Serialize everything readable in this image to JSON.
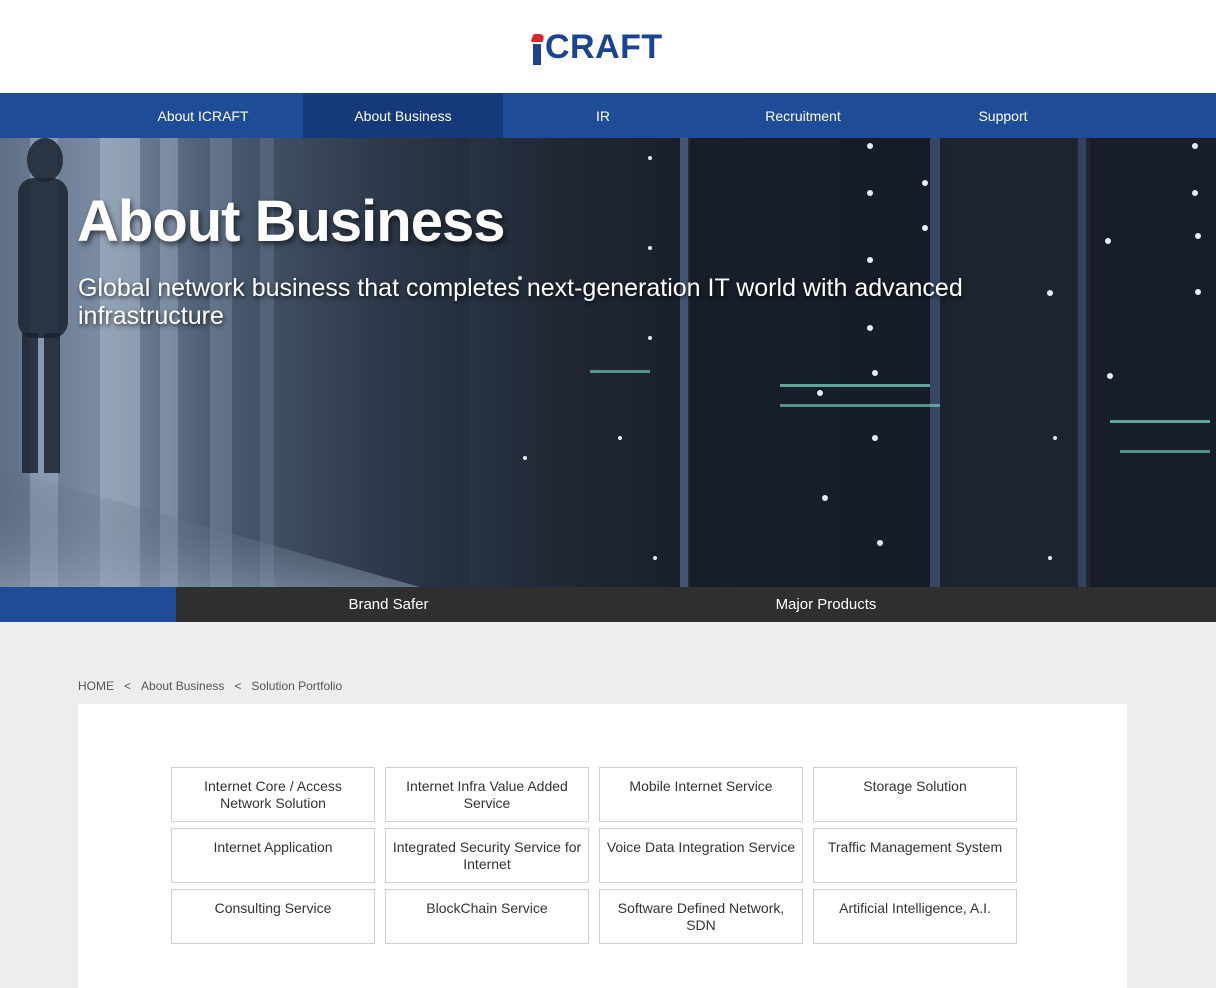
{
  "brand": {
    "logo_text": "CRAFT",
    "logo_alt": "ICRAFT"
  },
  "nav": {
    "items": [
      {
        "label": "About ICRAFT"
      },
      {
        "label": "About Business",
        "active": true
      },
      {
        "label": "IR"
      },
      {
        "label": "Recruitment"
      },
      {
        "label": "Support"
      }
    ]
  },
  "hero": {
    "title": "About Business",
    "subtitle": "Global network business that completes next-generation IT world with advanced infrastructure"
  },
  "subtabs": [
    {
      "label": "Brand Safer"
    },
    {
      "label": "Major Products"
    }
  ],
  "breadcrumb": {
    "home": "HOME",
    "separator": "<",
    "section": "About Business",
    "page": "Solution Portfolio"
  },
  "portfolio": [
    "Internet Core / Access Network Solution",
    "Internet Infra Value Added Service",
    "Mobile Internet Service",
    "Storage Solution",
    "Internet Application",
    "Integrated Security Service for Internet",
    "Voice Data Integration Service",
    "Traffic Management System",
    "Consulting Service",
    "BlockChain Service",
    "Software Defined Network, SDN",
    "Artificial Intelligence, A.I."
  ],
  "colors": {
    "brand_blue": "#1f4c96",
    "nav_active": "#163a79",
    "logo_red": "#d7262d",
    "subtab_bg": "#2f2f2f"
  }
}
